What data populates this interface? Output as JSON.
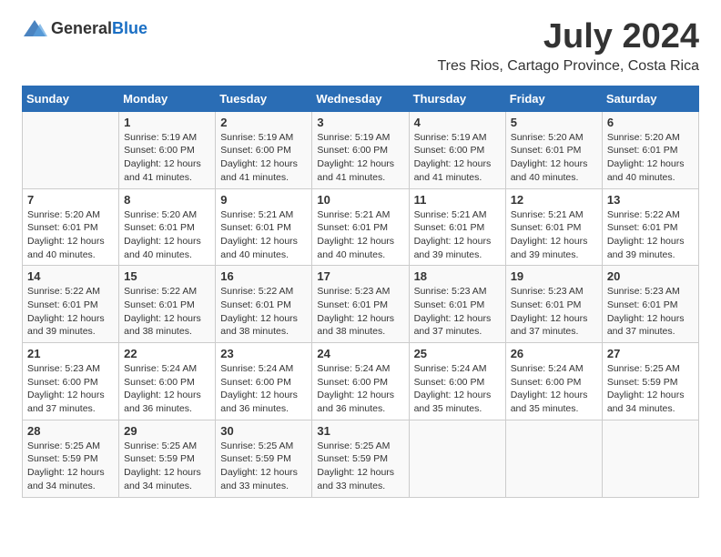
{
  "logo": {
    "text_general": "General",
    "text_blue": "Blue"
  },
  "title": {
    "month_year": "July 2024",
    "location": "Tres Rios, Cartago Province, Costa Rica"
  },
  "headers": [
    "Sunday",
    "Monday",
    "Tuesday",
    "Wednesday",
    "Thursday",
    "Friday",
    "Saturday"
  ],
  "weeks": [
    [
      {
        "day": "",
        "sunrise": "",
        "sunset": "",
        "daylight": ""
      },
      {
        "day": "1",
        "sunrise": "Sunrise: 5:19 AM",
        "sunset": "Sunset: 6:00 PM",
        "daylight": "Daylight: 12 hours and 41 minutes."
      },
      {
        "day": "2",
        "sunrise": "Sunrise: 5:19 AM",
        "sunset": "Sunset: 6:00 PM",
        "daylight": "Daylight: 12 hours and 41 minutes."
      },
      {
        "day": "3",
        "sunrise": "Sunrise: 5:19 AM",
        "sunset": "Sunset: 6:00 PM",
        "daylight": "Daylight: 12 hours and 41 minutes."
      },
      {
        "day": "4",
        "sunrise": "Sunrise: 5:19 AM",
        "sunset": "Sunset: 6:00 PM",
        "daylight": "Daylight: 12 hours and 41 minutes."
      },
      {
        "day": "5",
        "sunrise": "Sunrise: 5:20 AM",
        "sunset": "Sunset: 6:01 PM",
        "daylight": "Daylight: 12 hours and 40 minutes."
      },
      {
        "day": "6",
        "sunrise": "Sunrise: 5:20 AM",
        "sunset": "Sunset: 6:01 PM",
        "daylight": "Daylight: 12 hours and 40 minutes."
      }
    ],
    [
      {
        "day": "7",
        "sunrise": "Sunrise: 5:20 AM",
        "sunset": "Sunset: 6:01 PM",
        "daylight": "Daylight: 12 hours and 40 minutes."
      },
      {
        "day": "8",
        "sunrise": "Sunrise: 5:20 AM",
        "sunset": "Sunset: 6:01 PM",
        "daylight": "Daylight: 12 hours and 40 minutes."
      },
      {
        "day": "9",
        "sunrise": "Sunrise: 5:21 AM",
        "sunset": "Sunset: 6:01 PM",
        "daylight": "Daylight: 12 hours and 40 minutes."
      },
      {
        "day": "10",
        "sunrise": "Sunrise: 5:21 AM",
        "sunset": "Sunset: 6:01 PM",
        "daylight": "Daylight: 12 hours and 40 minutes."
      },
      {
        "day": "11",
        "sunrise": "Sunrise: 5:21 AM",
        "sunset": "Sunset: 6:01 PM",
        "daylight": "Daylight: 12 hours and 39 minutes."
      },
      {
        "day": "12",
        "sunrise": "Sunrise: 5:21 AM",
        "sunset": "Sunset: 6:01 PM",
        "daylight": "Daylight: 12 hours and 39 minutes."
      },
      {
        "day": "13",
        "sunrise": "Sunrise: 5:22 AM",
        "sunset": "Sunset: 6:01 PM",
        "daylight": "Daylight: 12 hours and 39 minutes."
      }
    ],
    [
      {
        "day": "14",
        "sunrise": "Sunrise: 5:22 AM",
        "sunset": "Sunset: 6:01 PM",
        "daylight": "Daylight: 12 hours and 39 minutes."
      },
      {
        "day": "15",
        "sunrise": "Sunrise: 5:22 AM",
        "sunset": "Sunset: 6:01 PM",
        "daylight": "Daylight: 12 hours and 38 minutes."
      },
      {
        "day": "16",
        "sunrise": "Sunrise: 5:22 AM",
        "sunset": "Sunset: 6:01 PM",
        "daylight": "Daylight: 12 hours and 38 minutes."
      },
      {
        "day": "17",
        "sunrise": "Sunrise: 5:23 AM",
        "sunset": "Sunset: 6:01 PM",
        "daylight": "Daylight: 12 hours and 38 minutes."
      },
      {
        "day": "18",
        "sunrise": "Sunrise: 5:23 AM",
        "sunset": "Sunset: 6:01 PM",
        "daylight": "Daylight: 12 hours and 37 minutes."
      },
      {
        "day": "19",
        "sunrise": "Sunrise: 5:23 AM",
        "sunset": "Sunset: 6:01 PM",
        "daylight": "Daylight: 12 hours and 37 minutes."
      },
      {
        "day": "20",
        "sunrise": "Sunrise: 5:23 AM",
        "sunset": "Sunset: 6:01 PM",
        "daylight": "Daylight: 12 hours and 37 minutes."
      }
    ],
    [
      {
        "day": "21",
        "sunrise": "Sunrise: 5:23 AM",
        "sunset": "Sunset: 6:00 PM",
        "daylight": "Daylight: 12 hours and 37 minutes."
      },
      {
        "day": "22",
        "sunrise": "Sunrise: 5:24 AM",
        "sunset": "Sunset: 6:00 PM",
        "daylight": "Daylight: 12 hours and 36 minutes."
      },
      {
        "day": "23",
        "sunrise": "Sunrise: 5:24 AM",
        "sunset": "Sunset: 6:00 PM",
        "daylight": "Daylight: 12 hours and 36 minutes."
      },
      {
        "day": "24",
        "sunrise": "Sunrise: 5:24 AM",
        "sunset": "Sunset: 6:00 PM",
        "daylight": "Daylight: 12 hours and 36 minutes."
      },
      {
        "day": "25",
        "sunrise": "Sunrise: 5:24 AM",
        "sunset": "Sunset: 6:00 PM",
        "daylight": "Daylight: 12 hours and 35 minutes."
      },
      {
        "day": "26",
        "sunrise": "Sunrise: 5:24 AM",
        "sunset": "Sunset: 6:00 PM",
        "daylight": "Daylight: 12 hours and 35 minutes."
      },
      {
        "day": "27",
        "sunrise": "Sunrise: 5:25 AM",
        "sunset": "Sunset: 5:59 PM",
        "daylight": "Daylight: 12 hours and 34 minutes."
      }
    ],
    [
      {
        "day": "28",
        "sunrise": "Sunrise: 5:25 AM",
        "sunset": "Sunset: 5:59 PM",
        "daylight": "Daylight: 12 hours and 34 minutes."
      },
      {
        "day": "29",
        "sunrise": "Sunrise: 5:25 AM",
        "sunset": "Sunset: 5:59 PM",
        "daylight": "Daylight: 12 hours and 34 minutes."
      },
      {
        "day": "30",
        "sunrise": "Sunrise: 5:25 AM",
        "sunset": "Sunset: 5:59 PM",
        "daylight": "Daylight: 12 hours and 33 minutes."
      },
      {
        "day": "31",
        "sunrise": "Sunrise: 5:25 AM",
        "sunset": "Sunset: 5:59 PM",
        "daylight": "Daylight: 12 hours and 33 minutes."
      },
      {
        "day": "",
        "sunrise": "",
        "sunset": "",
        "daylight": ""
      },
      {
        "day": "",
        "sunrise": "",
        "sunset": "",
        "daylight": ""
      },
      {
        "day": "",
        "sunrise": "",
        "sunset": "",
        "daylight": ""
      }
    ]
  ]
}
